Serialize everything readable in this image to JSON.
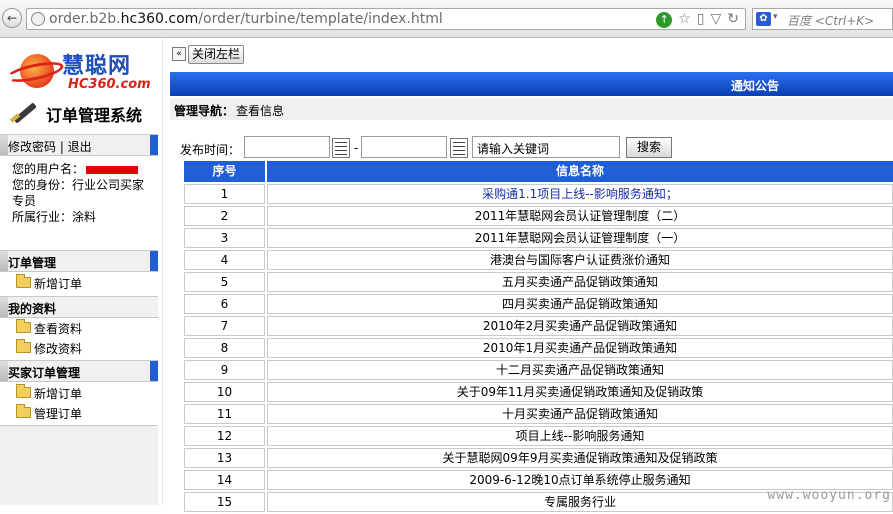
{
  "browser": {
    "url_prefix": "order.b2b.",
    "url_host": "hc360.com",
    "url_path": "/order/turbine/template/index.html",
    "search_placeholder": "百度 <Ctrl+K>"
  },
  "sidebar": {
    "logo_cn": "慧聪网",
    "logo_en": "HC360.com",
    "system_title": "订单管理系统",
    "account_links": "修改密码 | 退出",
    "user_name_label": "您的用户名：",
    "user_role": "您的身份：行业公司买家专员",
    "user_industry": "所属行业：涂料",
    "sections": [
      {
        "title": "订单管理",
        "items": [
          "新增订单"
        ]
      },
      {
        "title": "我的资料",
        "items": [
          "查看资料",
          "修改资料"
        ]
      },
      {
        "title": "买家订单管理",
        "items": [
          "新增订单",
          "管理订单"
        ]
      }
    ]
  },
  "main": {
    "toggle_glyph": "«",
    "close_sidebar_label": "关闭左栏",
    "notice_title": "通知公告",
    "nav_label": "管理导航：",
    "nav_value": "查看信息",
    "filter": {
      "date_label": "发布时间：",
      "dash": "-",
      "keyword_value": "请输入关键词",
      "search_label": "搜索"
    },
    "table": {
      "headers": [
        "序号",
        "信息名称"
      ],
      "rows": [
        {
          "no": "1",
          "title": "采购通1.1项目上线--影响服务通知；"
        },
        {
          "no": "2",
          "title": "2011年慧聪网会员认证管理制度（二）"
        },
        {
          "no": "3",
          "title": "2011年慧聪网会员认证管理制度（一）"
        },
        {
          "no": "4",
          "title": "港澳台与国际客户认证费涨价通知"
        },
        {
          "no": "5",
          "title": "五月买卖通产品促销政策通知"
        },
        {
          "no": "6",
          "title": "四月买卖通产品促销政策通知"
        },
        {
          "no": "7",
          "title": "2010年2月买卖通产品促销政策通知"
        },
        {
          "no": "8",
          "title": "2010年1月买卖通产品促销政策通知"
        },
        {
          "no": "9",
          "title": "十二月买卖通产品促销政策通知"
        },
        {
          "no": "10",
          "title": "关于09年11月买卖通促销政策通知及促销政策"
        },
        {
          "no": "11",
          "title": "十月买卖通产品促销政策通知"
        },
        {
          "no": "12",
          "title": "项目上线--影响服务通知"
        },
        {
          "no": "13",
          "title": "关于慧聪网09年9月买卖通促销政策通知及促销政策"
        },
        {
          "no": "14",
          "title": "2009-6-12晚10点订单系统停止服务通知"
        },
        {
          "no": "15",
          "title": "专属服务行业"
        }
      ]
    }
  },
  "watermark": "www.wooyun.org"
}
